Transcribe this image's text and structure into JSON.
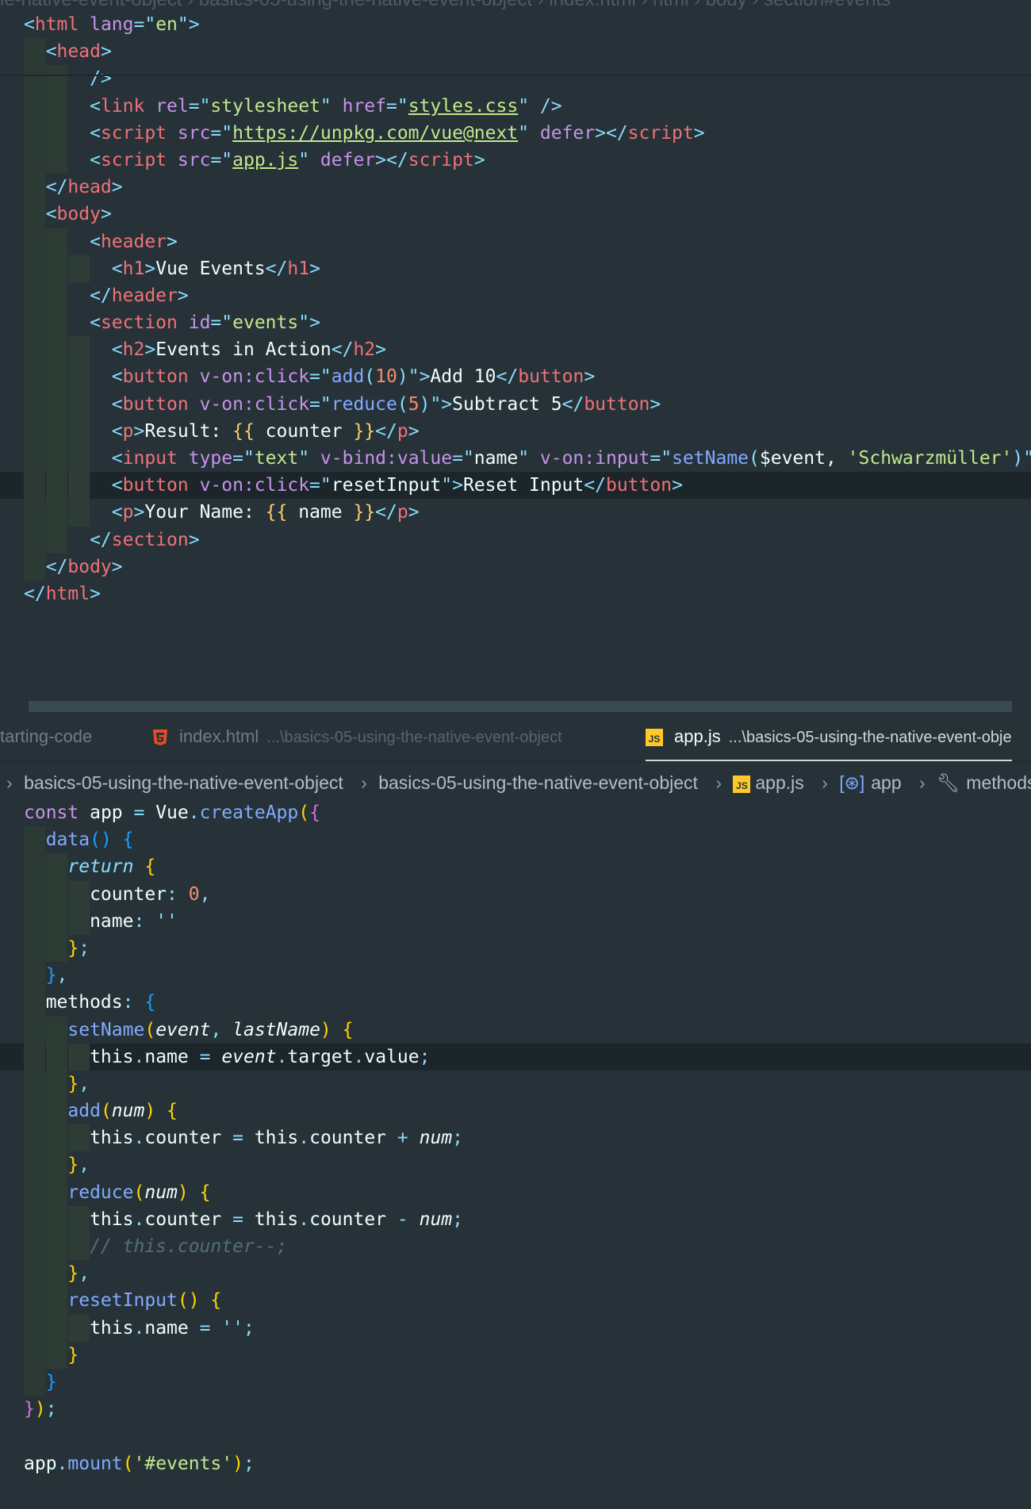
{
  "top_breadcrumb": "le-native-event-object  ›  basics-05-using-the-native-event-object  ›  index.html  ›  html  ›  body  ›  section#events",
  "html_lines": [
    [
      {
        "t": "<",
        "c": "punc"
      },
      {
        "t": "html",
        "c": "tag"
      },
      {
        "t": " lang",
        "c": "attr"
      },
      {
        "t": "=\"",
        "c": "punc"
      },
      {
        "t": "en",
        "c": "str"
      },
      {
        "t": "\">",
        "c": "punc"
      }
    ],
    [
      {
        "t": "  <",
        "c": "punc"
      },
      {
        "t": "head",
        "c": "tag"
      },
      {
        "t": ">",
        "c": "punc"
      }
    ],
    [
      {
        "t": "      />",
        "c": "punc"
      }
    ],
    [
      {
        "t": "      <",
        "c": "punc"
      },
      {
        "t": "link",
        "c": "tag"
      },
      {
        "t": " rel",
        "c": "attr"
      },
      {
        "t": "=\"",
        "c": "punc"
      },
      {
        "t": "stylesheet",
        "c": "str"
      },
      {
        "t": "\"",
        "c": "punc"
      },
      {
        "t": " href",
        "c": "attr"
      },
      {
        "t": "=\"",
        "c": "punc"
      },
      {
        "t": "styles.css",
        "c": "link"
      },
      {
        "t": "\"",
        "c": "punc"
      },
      {
        "t": " />",
        "c": "punc"
      }
    ],
    [
      {
        "t": "      <",
        "c": "punc"
      },
      {
        "t": "script",
        "c": "tag"
      },
      {
        "t": " src",
        "c": "attr"
      },
      {
        "t": "=\"",
        "c": "punc"
      },
      {
        "t": "https://unpkg.com/vue@next",
        "c": "link"
      },
      {
        "t": "\"",
        "c": "punc"
      },
      {
        "t": " defer",
        "c": "attr"
      },
      {
        "t": "></",
        "c": "punc"
      },
      {
        "t": "script",
        "c": "tag"
      },
      {
        "t": ">",
        "c": "punc"
      }
    ],
    [
      {
        "t": "      <",
        "c": "punc"
      },
      {
        "t": "script",
        "c": "tag"
      },
      {
        "t": " src",
        "c": "attr"
      },
      {
        "t": "=\"",
        "c": "punc"
      },
      {
        "t": "app.js",
        "c": "link"
      },
      {
        "t": "\"",
        "c": "punc"
      },
      {
        "t": " defer",
        "c": "attr"
      },
      {
        "t": "></",
        "c": "punc"
      },
      {
        "t": "script",
        "c": "tag"
      },
      {
        "t": ">",
        "c": "punc"
      }
    ],
    [
      {
        "t": "  </",
        "c": "punc"
      },
      {
        "t": "head",
        "c": "tag"
      },
      {
        "t": ">",
        "c": "punc"
      }
    ],
    [
      {
        "t": "  <",
        "c": "punc"
      },
      {
        "t": "body",
        "c": "tag"
      },
      {
        "t": ">",
        "c": "punc"
      }
    ],
    [
      {
        "t": "      <",
        "c": "punc"
      },
      {
        "t": "header",
        "c": "tag"
      },
      {
        "t": ">",
        "c": "punc"
      }
    ],
    [
      {
        "t": "        <",
        "c": "punc"
      },
      {
        "t": "h1",
        "c": "tag"
      },
      {
        "t": ">",
        "c": "punc"
      },
      {
        "t": "Vue Events",
        "c": "prop"
      },
      {
        "t": "</",
        "c": "punc"
      },
      {
        "t": "h1",
        "c": "tag"
      },
      {
        "t": ">",
        "c": "punc"
      }
    ],
    [
      {
        "t": "      </",
        "c": "punc"
      },
      {
        "t": "header",
        "c": "tag"
      },
      {
        "t": ">",
        "c": "punc"
      }
    ],
    [
      {
        "t": "      <",
        "c": "punc"
      },
      {
        "t": "section",
        "c": "tag"
      },
      {
        "t": " id",
        "c": "attr"
      },
      {
        "t": "=\"",
        "c": "punc"
      },
      {
        "t": "events",
        "c": "str"
      },
      {
        "t": "\">",
        "c": "punc"
      }
    ],
    [
      {
        "t": "        <",
        "c": "punc"
      },
      {
        "t": "h2",
        "c": "tag"
      },
      {
        "t": ">",
        "c": "punc"
      },
      {
        "t": "Events in Action",
        "c": "prop"
      },
      {
        "t": "</",
        "c": "punc"
      },
      {
        "t": "h2",
        "c": "tag"
      },
      {
        "t": ">",
        "c": "punc"
      }
    ],
    [
      {
        "t": "        <",
        "c": "punc"
      },
      {
        "t": "button",
        "c": "tag"
      },
      {
        "t": " v-on:click",
        "c": "attr"
      },
      {
        "t": "=\"",
        "c": "punc"
      },
      {
        "t": "add",
        "c": "fn"
      },
      {
        "t": "(",
        "c": "punc"
      },
      {
        "t": "10",
        "c": "num"
      },
      {
        "t": ")",
        "c": "punc"
      },
      {
        "t": "\">",
        "c": "punc"
      },
      {
        "t": "Add 10",
        "c": "prop"
      },
      {
        "t": "</",
        "c": "punc"
      },
      {
        "t": "button",
        "c": "tag"
      },
      {
        "t": ">",
        "c": "punc"
      }
    ],
    [
      {
        "t": "        <",
        "c": "punc"
      },
      {
        "t": "button",
        "c": "tag"
      },
      {
        "t": " v-on:click",
        "c": "attr"
      },
      {
        "t": "=\"",
        "c": "punc"
      },
      {
        "t": "reduce",
        "c": "fn"
      },
      {
        "t": "(",
        "c": "punc"
      },
      {
        "t": "5",
        "c": "num"
      },
      {
        "t": ")",
        "c": "punc"
      },
      {
        "t": "\">",
        "c": "punc"
      },
      {
        "t": "Subtract 5",
        "c": "prop"
      },
      {
        "t": "</",
        "c": "punc"
      },
      {
        "t": "button",
        "c": "tag"
      },
      {
        "t": ">",
        "c": "punc"
      }
    ],
    [
      {
        "t": "        <",
        "c": "punc"
      },
      {
        "t": "p",
        "c": "tag"
      },
      {
        "t": ">",
        "c": "punc"
      },
      {
        "t": "Result: ",
        "c": "prop"
      },
      {
        "t": "{{",
        "c": "tmpl"
      },
      {
        "t": " counter ",
        "c": "prop"
      },
      {
        "t": "}}",
        "c": "tmpl"
      },
      {
        "t": "</",
        "c": "punc"
      },
      {
        "t": "p",
        "c": "tag"
      },
      {
        "t": ">",
        "c": "punc"
      }
    ],
    [
      {
        "t": "        <",
        "c": "punc"
      },
      {
        "t": "input",
        "c": "tag"
      },
      {
        "t": " type",
        "c": "attr"
      },
      {
        "t": "=\"",
        "c": "punc"
      },
      {
        "t": "text",
        "c": "str"
      },
      {
        "t": "\"",
        "c": "punc"
      },
      {
        "t": " v-bind:value",
        "c": "attr"
      },
      {
        "t": "=\"",
        "c": "punc"
      },
      {
        "t": "name",
        "c": "prop"
      },
      {
        "t": "\"",
        "c": "punc"
      },
      {
        "t": " v-on:input",
        "c": "attr"
      },
      {
        "t": "=\"",
        "c": "punc"
      },
      {
        "t": "setName",
        "c": "fn"
      },
      {
        "t": "(",
        "c": "punc"
      },
      {
        "t": "$event, ",
        "c": "prop"
      },
      {
        "t": "'Schwarzmüller'",
        "c": "str"
      },
      {
        "t": ")",
        "c": "punc"
      },
      {
        "t": "\">",
        "c": "punc"
      }
    ],
    [
      {
        "t": "        <",
        "c": "punc"
      },
      {
        "t": "button",
        "c": "tag"
      },
      {
        "t": " v-on:click",
        "c": "attr"
      },
      {
        "t": "=\"",
        "c": "punc"
      },
      {
        "t": "resetInput",
        "c": "prop"
      },
      {
        "t": "\">",
        "c": "punc"
      },
      {
        "t": "Reset Input",
        "c": "prop"
      },
      {
        "t": "</",
        "c": "punc"
      },
      {
        "t": "button",
        "c": "tag"
      },
      {
        "t": ">",
        "c": "punc"
      }
    ],
    [
      {
        "t": "        <",
        "c": "punc"
      },
      {
        "t": "p",
        "c": "tag"
      },
      {
        "t": ">",
        "c": "punc"
      },
      {
        "t": "Your Name: ",
        "c": "prop"
      },
      {
        "t": "{{",
        "c": "tmpl"
      },
      {
        "t": " name ",
        "c": "prop"
      },
      {
        "t": "}}",
        "c": "tmpl"
      },
      {
        "t": "</",
        "c": "punc"
      },
      {
        "t": "p",
        "c": "tag"
      },
      {
        "t": ">",
        "c": "punc"
      }
    ],
    [
      {
        "t": "      </",
        "c": "punc"
      },
      {
        "t": "section",
        "c": "tag"
      },
      {
        "t": ">",
        "c": "punc"
      }
    ],
    [
      {
        "t": "  </",
        "c": "punc"
      },
      {
        "t": "body",
        "c": "tag"
      },
      {
        "t": ">",
        "c": "punc"
      }
    ],
    [
      {
        "t": "</",
        "c": "punc"
      },
      {
        "t": "html",
        "c": "tag"
      },
      {
        "t": ">",
        "c": "punc"
      }
    ]
  ],
  "tabs": [
    {
      "label": "tarting-code",
      "path": "",
      "active": false,
      "icon": "none"
    },
    {
      "label": "index.html",
      "path": "...\\basics-05-using-the-native-event-object",
      "active": false,
      "icon": "html5-icon"
    },
    {
      "label": "app.js",
      "path": "...\\basics-05-using-the-native-event-obje",
      "active": true,
      "icon": "js-icon"
    }
  ],
  "breadcrumbs": [
    "basics-05-using-the-native-event-object",
    "basics-05-using-the-native-event-object",
    "app.js",
    "app",
    "methods"
  ],
  "js_lines": [
    [
      {
        "t": "const",
        "c": "kw"
      },
      {
        "t": " app ",
        "c": "prop"
      },
      {
        "t": "=",
        "c": "op"
      },
      {
        "t": " Vue",
        "c": "prop"
      },
      {
        "t": ".",
        "c": "op"
      },
      {
        "t": "createApp",
        "c": "fn"
      },
      {
        "t": "(",
        "c": "br1"
      },
      {
        "t": "{",
        "c": "br2"
      }
    ],
    [
      {
        "t": "  data",
        "c": "fn"
      },
      {
        "t": "()",
        "c": "br3"
      },
      {
        "t": " {",
        "c": "br3"
      }
    ],
    [
      {
        "t": "    return",
        "c": "ret"
      },
      {
        "t": " {",
        "c": "br1"
      }
    ],
    [
      {
        "t": "      counter",
        "c": "prop"
      },
      {
        "t": ": ",
        "c": "op"
      },
      {
        "t": "0",
        "c": "num"
      },
      {
        "t": ",",
        "c": "op"
      }
    ],
    [
      {
        "t": "      name",
        "c": "prop"
      },
      {
        "t": ": ",
        "c": "op"
      },
      {
        "t": "''",
        "c": "op"
      }
    ],
    [
      {
        "t": "    }",
        "c": "br1"
      },
      {
        "t": ";",
        "c": "op"
      }
    ],
    [
      {
        "t": "  }",
        "c": "br3"
      },
      {
        "t": ",",
        "c": "op"
      }
    ],
    [
      {
        "t": "  methods",
        "c": "prop"
      },
      {
        "t": ": ",
        "c": "op"
      },
      {
        "t": "{",
        "c": "br3"
      }
    ],
    [
      {
        "t": "    setName",
        "c": "fn"
      },
      {
        "t": "(",
        "c": "br1"
      },
      {
        "t": "event",
        "c": "param"
      },
      {
        "t": ", ",
        "c": "op"
      },
      {
        "t": "lastName",
        "c": "param"
      },
      {
        "t": ")",
        "c": "br1"
      },
      {
        "t": " {",
        "c": "br1"
      }
    ],
    [
      {
        "t": "      this",
        "c": "this"
      },
      {
        "t": ".",
        "c": "op"
      },
      {
        "t": "name ",
        "c": "prop"
      },
      {
        "t": "=",
        "c": "op"
      },
      {
        "t": " ",
        "c": "prop"
      },
      {
        "t": "event",
        "c": "param"
      },
      {
        "t": ".",
        "c": "op"
      },
      {
        "t": "target",
        "c": "prop"
      },
      {
        "t": ".",
        "c": "op"
      },
      {
        "t": "value",
        "c": "prop"
      },
      {
        "t": ";",
        "c": "op"
      }
    ],
    [
      {
        "t": "    }",
        "c": "br1"
      },
      {
        "t": ",",
        "c": "op"
      }
    ],
    [
      {
        "t": "    add",
        "c": "fn"
      },
      {
        "t": "(",
        "c": "br1"
      },
      {
        "t": "num",
        "c": "param"
      },
      {
        "t": ")",
        "c": "br1"
      },
      {
        "t": " {",
        "c": "br1"
      }
    ],
    [
      {
        "t": "      this",
        "c": "this"
      },
      {
        "t": ".",
        "c": "op"
      },
      {
        "t": "counter ",
        "c": "prop"
      },
      {
        "t": "=",
        "c": "op"
      },
      {
        "t": " this",
        "c": "this"
      },
      {
        "t": ".",
        "c": "op"
      },
      {
        "t": "counter ",
        "c": "prop"
      },
      {
        "t": "+",
        "c": "op"
      },
      {
        "t": " ",
        "c": "prop"
      },
      {
        "t": "num",
        "c": "param"
      },
      {
        "t": ";",
        "c": "op"
      }
    ],
    [
      {
        "t": "    }",
        "c": "br1"
      },
      {
        "t": ",",
        "c": "op"
      }
    ],
    [
      {
        "t": "    reduce",
        "c": "fn"
      },
      {
        "t": "(",
        "c": "br1"
      },
      {
        "t": "num",
        "c": "param"
      },
      {
        "t": ")",
        "c": "br1"
      },
      {
        "t": " {",
        "c": "br1"
      }
    ],
    [
      {
        "t": "      this",
        "c": "this"
      },
      {
        "t": ".",
        "c": "op"
      },
      {
        "t": "counter ",
        "c": "prop"
      },
      {
        "t": "=",
        "c": "op"
      },
      {
        "t": " this",
        "c": "this"
      },
      {
        "t": ".",
        "c": "op"
      },
      {
        "t": "counter ",
        "c": "prop"
      },
      {
        "t": "-",
        "c": "op"
      },
      {
        "t": " ",
        "c": "prop"
      },
      {
        "t": "num",
        "c": "param"
      },
      {
        "t": ";",
        "c": "op"
      }
    ],
    [
      {
        "t": "      // this.counter--;",
        "c": "cmt"
      }
    ],
    [
      {
        "t": "    }",
        "c": "br1"
      },
      {
        "t": ",",
        "c": "op"
      }
    ],
    [
      {
        "t": "    resetInput",
        "c": "fn"
      },
      {
        "t": "()",
        "c": "br1"
      },
      {
        "t": " {",
        "c": "br1"
      }
    ],
    [
      {
        "t": "      this",
        "c": "this"
      },
      {
        "t": ".",
        "c": "op"
      },
      {
        "t": "name ",
        "c": "prop"
      },
      {
        "t": "=",
        "c": "op"
      },
      {
        "t": " ''",
        "c": "op"
      },
      {
        "t": ";",
        "c": "op"
      }
    ],
    [
      {
        "t": "    }",
        "c": "br1"
      }
    ],
    [
      {
        "t": "  }",
        "c": "br3"
      }
    ],
    [
      {
        "t": "}",
        "c": "br2"
      },
      {
        "t": ")",
        "c": "br1"
      },
      {
        "t": ";",
        "c": "op"
      }
    ],
    [],
    [
      {
        "t": "app",
        "c": "prop"
      },
      {
        "t": ".",
        "c": "op"
      },
      {
        "t": "mount",
        "c": "fn"
      },
      {
        "t": "(",
        "c": "br1"
      },
      {
        "t": "'#events'",
        "c": "str"
      },
      {
        "t": ")",
        "c": "br1"
      },
      {
        "t": ";",
        "c": "op"
      }
    ]
  ],
  "html_current_line": 17,
  "js_current_line": 9
}
